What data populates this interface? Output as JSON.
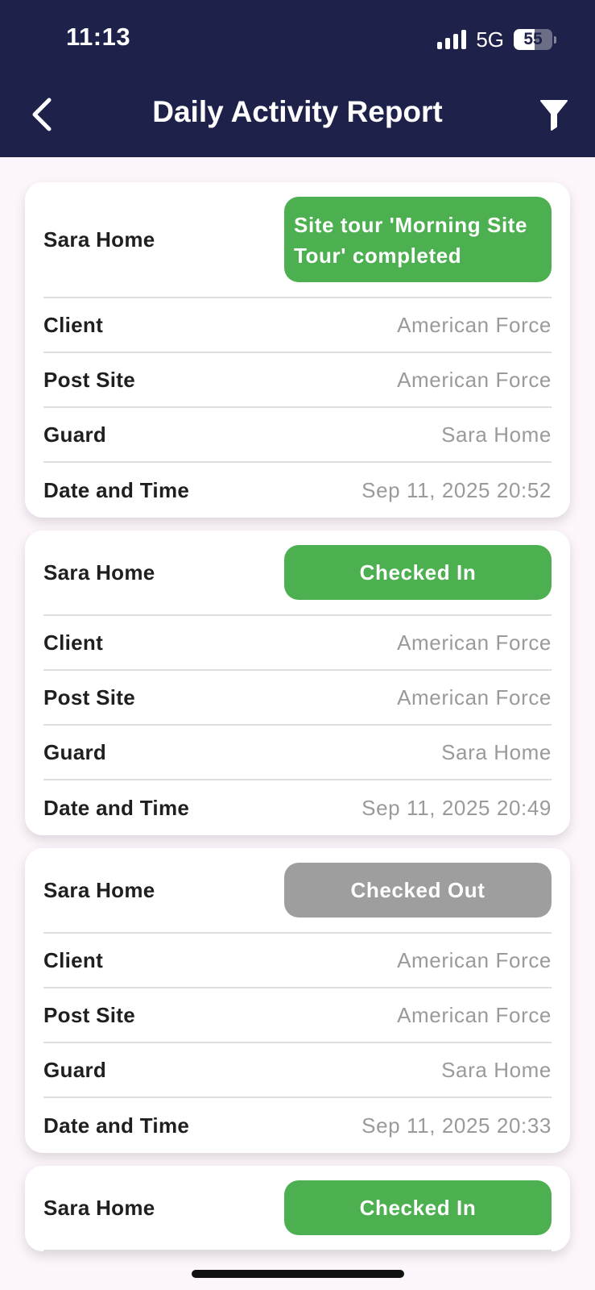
{
  "status_bar": {
    "time": "11:13",
    "network": "5G",
    "battery": "55",
    "battery_level": 0.55
  },
  "header": {
    "title": "Daily Activity Report",
    "back_icon": "chevron-left-icon",
    "filter_icon": "filter-icon"
  },
  "colors": {
    "header_bg": "#1e2149",
    "badge_green": "#4caf50",
    "badge_gray": "#9e9e9e",
    "page_bg": "#fcf6fc"
  },
  "labels": {
    "client": "Client",
    "post_site": "Post Site",
    "guard": "Guard",
    "date_time": "Date and Time"
  },
  "cards": [
    {
      "name": "Sara Home",
      "status": "Site tour 'Morning Site Tour' completed",
      "status_color": "green",
      "client": "American Force",
      "post_site": "American Force",
      "guard": "Sara Home",
      "date_time": "Sep 11, 2025 20:52"
    },
    {
      "name": "Sara Home",
      "status": "Checked In",
      "status_color": "green",
      "client": "American Force",
      "post_site": "American Force",
      "guard": "Sara Home",
      "date_time": "Sep 11, 2025 20:49"
    },
    {
      "name": "Sara Home",
      "status": "Checked Out",
      "status_color": "gray",
      "client": "American Force",
      "post_site": "American Force",
      "guard": "Sara Home",
      "date_time": "Sep 11, 2025 20:33"
    },
    {
      "name": "Sara Home",
      "status": "Checked In",
      "status_color": "green"
    }
  ]
}
